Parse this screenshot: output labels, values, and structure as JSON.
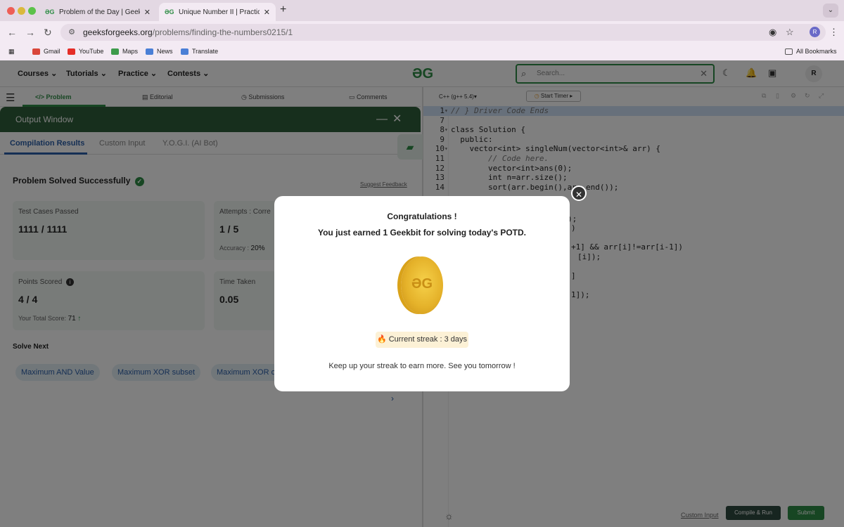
{
  "browser": {
    "tabs": [
      {
        "title": "Problem of the Day | Geeksfo",
        "active": false
      },
      {
        "title": "Unique Number II | Practice | (",
        "active": true
      }
    ],
    "new_tab": "+",
    "tab_menu": "⌄",
    "url_site": "geeksforgeeks.org",
    "url_path": "/problems/finding-the-numbers0215/1",
    "profile_initial": "R",
    "bookmarks": [
      "Gmail",
      "YouTube",
      "Maps",
      "News",
      "Translate"
    ],
    "all_bookmarks": "All Bookmarks"
  },
  "gfg_nav": {
    "items": [
      "Courses",
      "Tutorials",
      "Practice",
      "Contests"
    ],
    "logo": "ƏG",
    "search_placeholder": "Search...",
    "avatar": "R"
  },
  "problem_tabs": [
    "Problem",
    "Editorial",
    "Submissions",
    "Comments"
  ],
  "output_window": {
    "title": "Output Window",
    "tabs": [
      "Compilation Results",
      "Custom Input",
      "Y.O.G.I. (AI Bot)"
    ],
    "status": "Problem Solved Successfully",
    "feedback": "Suggest Feedback",
    "cards": {
      "test_cases_label": "Test Cases Passed",
      "test_cases_value": "1111 / 1111",
      "attempts_label": "Attempts : Corre",
      "attempts_value": "1 / 5",
      "accuracy_label": "Accuracy :",
      "accuracy_value": "20%",
      "points_label": "Points Scored",
      "points_value": "4 / 4",
      "total_label": "Your Total Score:",
      "total_value": "71",
      "time_label": "Time Taken",
      "time_value": "0.05"
    },
    "solve_next_label": "Solve Next",
    "solve_next": [
      "Maximum AND Value",
      "Maximum XOR subset",
      "Maximum XOR o"
    ]
  },
  "editor": {
    "language": "C++ (g++ 5.4)",
    "timer": "Start Timer",
    "code_lines": [
      {
        "n": "1",
        "fold": true,
        "text": "// } Driver Code Ends",
        "hl": true,
        "cls": "cm"
      },
      {
        "n": "7",
        "fold": false,
        "text": "",
        "hl": false,
        "cls": ""
      },
      {
        "n": "8",
        "fold": true,
        "text": "class Solution {",
        "hl": false,
        "cls": ""
      },
      {
        "n": "9",
        "fold": false,
        "text": "  public:",
        "hl": false,
        "cls": ""
      },
      {
        "n": "10",
        "fold": true,
        "text": "    vector<int> singleNum(vector<int>& arr) {",
        "hl": false,
        "cls": ""
      },
      {
        "n": "11",
        "fold": false,
        "text": "        // Code here.",
        "hl": false,
        "cls": "cm"
      },
      {
        "n": "12",
        "fold": false,
        "text": "        vector<int>ans(0);",
        "hl": false,
        "cls": ""
      },
      {
        "n": "13",
        "fold": false,
        "text": "        int n=arr.size();",
        "hl": false,
        "cls": ""
      },
      {
        "n": "14",
        "fold": false,
        "text": "        sort(arr.begin(),arr.end());",
        "hl": false,
        "cls": ""
      }
    ],
    "code_fragments": [
      ");",
      ")",
      "+1] && arr[i]!=arr[i-1])",
      "[i]);",
      "]",
      "1]);"
    ],
    "custom_input": "Custom Input",
    "compile_run": "Compile & Run",
    "submit": "Submit"
  },
  "modal": {
    "title": "Congratulations !",
    "subtitle": "You just earned 1 Geekbit for solving today's POTD.",
    "streak": "🔥 Current streak : 3 days",
    "footer": "Keep up your streak to earn more. See you tomorrow !",
    "close": "✕"
  }
}
